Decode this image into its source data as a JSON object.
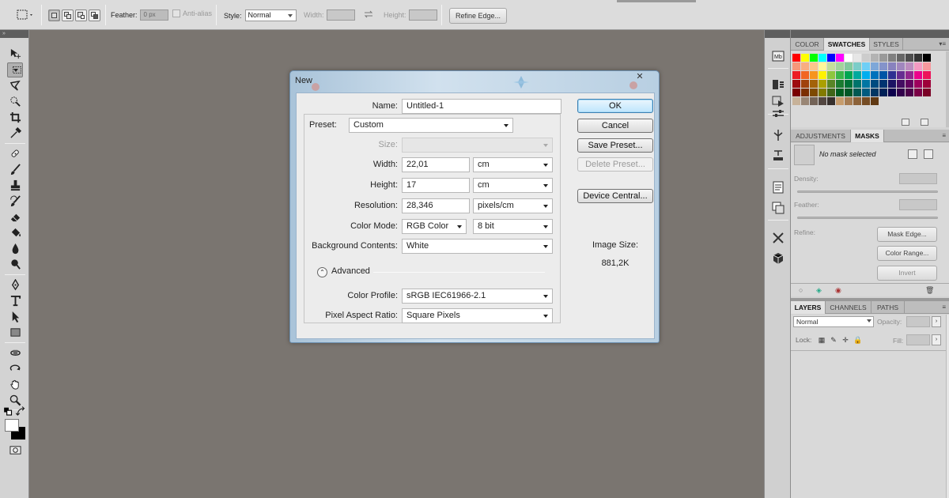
{
  "options_bar": {
    "feather_label": "Feather:",
    "feather_value": "0 px",
    "anti_alias_label": "Anti-alias",
    "style_label": "Style:",
    "style_value": "Normal",
    "width_label": "Width:",
    "height_label": "Height:",
    "refine_edge_label": "Refine Edge..."
  },
  "toolbar": {
    "tools": [
      "move-tool",
      "rectangular-marquee-tool",
      "lasso-tool",
      "quick-selection-tool",
      "crop-tool",
      "eyedropper-tool",
      "spot-healing-brush-tool",
      "brush-tool",
      "clone-stamp-tool",
      "history-brush-tool",
      "eraser-tool",
      "paint-bucket-tool",
      "blur-tool",
      "dodge-tool",
      "pen-tool",
      "type-tool",
      "path-selection-tool",
      "rectangle-tool",
      "3d-rotate-tool",
      "3d-orbit-tool",
      "hand-tool",
      "zoom-tool"
    ],
    "selected_tool": "rectangular-marquee-tool",
    "foreground_color": "#ffffff",
    "background_color": "#000000"
  },
  "dialog": {
    "title": "New",
    "name_label": "Name:",
    "name_value": "Untitled-1",
    "preset_label": "Preset:",
    "preset_value": "Custom",
    "size_label": "Size:",
    "size_value": "",
    "width_label": "Width:",
    "width_value": "22,01",
    "width_unit": "cm",
    "height_label": "Height:",
    "height_value": "17",
    "height_unit": "cm",
    "resolution_label": "Resolution:",
    "resolution_value": "28,346",
    "resolution_unit": "pixels/cm",
    "color_mode_label": "Color Mode:",
    "color_mode_value": "RGB Color",
    "bit_depth_value": "8 bit",
    "background_label": "Background Contents:",
    "background_value": "White",
    "advanced_label": "Advanced",
    "color_profile_label": "Color Profile:",
    "color_profile_value": "sRGB IEC61966-2.1",
    "pixel_aspect_label": "Pixel Aspect Ratio:",
    "pixel_aspect_value": "Square Pixels",
    "ok_label": "OK",
    "cancel_label": "Cancel",
    "save_preset_label": "Save Preset...",
    "delete_preset_label": "Delete Preset...",
    "device_central_label": "Device Central...",
    "image_size_label": "Image Size:",
    "image_size_value": "881,2K"
  },
  "swatches_panel": {
    "tabs": [
      "COLOR",
      "SWATCHES",
      "STYLES"
    ],
    "active_tab": "SWATCHES",
    "colors": [
      "#ff0000",
      "#ffff00",
      "#00ff00",
      "#00ffff",
      "#0000ff",
      "#ff00ff",
      "#ffffff",
      "#e6e6e6",
      "#cccccc",
      "#b3b3b3",
      "#999999",
      "#808080",
      "#666666",
      "#4d4d4d",
      "#333333",
      "#000000",
      "#f7977a",
      "#f9ad81",
      "#fdc68a",
      "#fff79a",
      "#c4df9b",
      "#a2d39c",
      "#82ca9d",
      "#7bcdc8",
      "#6ecff6",
      "#7ea7d8",
      "#8493ca",
      "#8882be",
      "#a187be",
      "#bc8dbf",
      "#f49ac2",
      "#f6989d",
      "#ed1c24",
      "#f26522",
      "#f7941d",
      "#fff200",
      "#8dc63f",
      "#39b54a",
      "#00a651",
      "#00a99d",
      "#00aeef",
      "#0072bc",
      "#0054a6",
      "#2e3192",
      "#662d91",
      "#92278f",
      "#ec008c",
      "#ed145b",
      "#9e0b0f",
      "#a0410d",
      "#a36209",
      "#aba000",
      "#598527",
      "#1a7b30",
      "#007236",
      "#00746b",
      "#0076a3",
      "#004b80",
      "#003471",
      "#1b1464",
      "#440e62",
      "#630460",
      "#9e005d",
      "#9e0039",
      "#790000",
      "#7b2e00",
      "#7d4900",
      "#827b00",
      "#406618",
      "#005e20",
      "#005826",
      "#005952",
      "#005b7f",
      "#003663",
      "#002157",
      "#0d004c",
      "#32004b",
      "#4b0049",
      "#7b0046",
      "#7a0026",
      "#c7b299",
      "#998675",
      "#736357",
      "#534741",
      "#37302d",
      "#c69c6d",
      "#a67c52",
      "#8c6239",
      "#754c24",
      "#603913"
    ]
  },
  "masks_panel": {
    "tabs": [
      "ADJUSTMENTS",
      "MASKS"
    ],
    "active_tab": "MASKS",
    "status": "No mask selected",
    "density_label": "Density:",
    "feather_label": "Feather:",
    "refine_label": "Refine:",
    "mask_edge_label": "Mask Edge...",
    "color_range_label": "Color Range...",
    "invert_label": "Invert"
  },
  "layers_panel": {
    "tabs": [
      "LAYERS",
      "CHANNELS",
      "PATHS"
    ],
    "active_tab": "LAYERS",
    "blend_mode": "Normal",
    "opacity_label": "Opacity:",
    "lock_label": "Lock:",
    "fill_label": "Fill:"
  }
}
